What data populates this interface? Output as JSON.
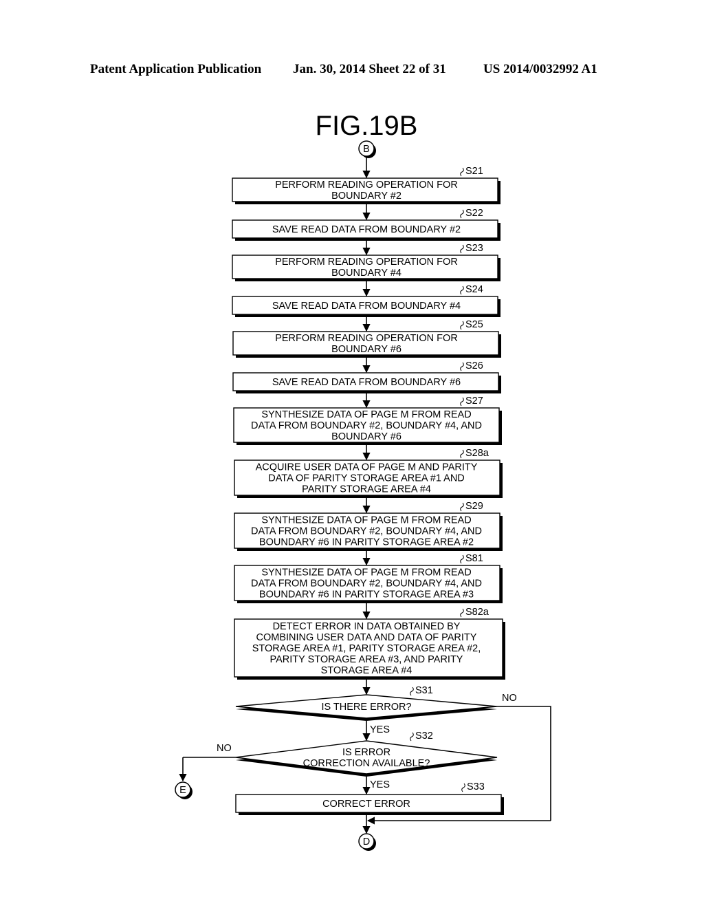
{
  "header": {
    "publication": "Patent Application Publication",
    "date_sheet": "Jan. 30, 2014  Sheet 22 of 31",
    "patent_number": "US 2014/0032992 A1"
  },
  "figure": {
    "title": "FIG.19B",
    "connectors": {
      "start": "B",
      "exit_no": "E",
      "end": "D"
    },
    "steps": [
      {
        "id": "S21",
        "lines": [
          "PERFORM READING OPERATION FOR",
          "BOUNDARY #2"
        ]
      },
      {
        "id": "S22",
        "lines": [
          "SAVE READ DATA FROM BOUNDARY #2"
        ]
      },
      {
        "id": "S23",
        "lines": [
          "PERFORM READING OPERATION FOR",
          "BOUNDARY #4"
        ]
      },
      {
        "id": "S24",
        "lines": [
          "SAVE READ DATA FROM BOUNDARY #4"
        ]
      },
      {
        "id": "S25",
        "lines": [
          "PERFORM READING OPERATION FOR",
          "BOUNDARY #6"
        ]
      },
      {
        "id": "S26",
        "lines": [
          "SAVE READ DATA FROM BOUNDARY #6"
        ]
      },
      {
        "id": "S27",
        "lines": [
          "SYNTHESIZE DATA OF PAGE M FROM READ",
          "DATA FROM BOUNDARY #2, BOUNDARY #4, AND",
          "BOUNDARY #6"
        ]
      },
      {
        "id": "S28a",
        "lines": [
          "ACQUIRE USER DATA OF PAGE M AND PARITY",
          "DATA OF PARITY STORAGE AREA #1 AND",
          "PARITY STORAGE AREA #4"
        ]
      },
      {
        "id": "S29",
        "lines": [
          "SYNTHESIZE DATA OF PAGE M FROM READ",
          "DATA FROM BOUNDARY #2, BOUNDARY #4, AND",
          "BOUNDARY #6 IN PARITY STORAGE AREA #2"
        ]
      },
      {
        "id": "S81",
        "lines": [
          "SYNTHESIZE DATA OF PAGE M FROM READ",
          "DATA FROM BOUNDARY #2, BOUNDARY #4, AND",
          "BOUNDARY #6 IN PARITY STORAGE AREA #3"
        ]
      },
      {
        "id": "S82a",
        "lines": [
          "DETECT ERROR IN DATA OBTAINED BY",
          "COMBINING USER DATA AND DATA OF PARITY",
          "STORAGE AREA #1, PARITY STORAGE AREA #2,",
          "PARITY STORAGE AREA #3, AND PARITY",
          "STORAGE AREA #4"
        ]
      }
    ],
    "decisions": [
      {
        "id": "S31",
        "lines": [
          "IS THERE ERROR?"
        ],
        "yes": "YES",
        "no": "NO"
      },
      {
        "id": "S32",
        "lines": [
          "IS ERROR",
          "CORRECTION AVAILABLE?"
        ],
        "yes": "YES",
        "no": "NO"
      }
    ],
    "final_step": {
      "id": "S33",
      "lines": [
        "CORRECT ERROR"
      ]
    }
  }
}
